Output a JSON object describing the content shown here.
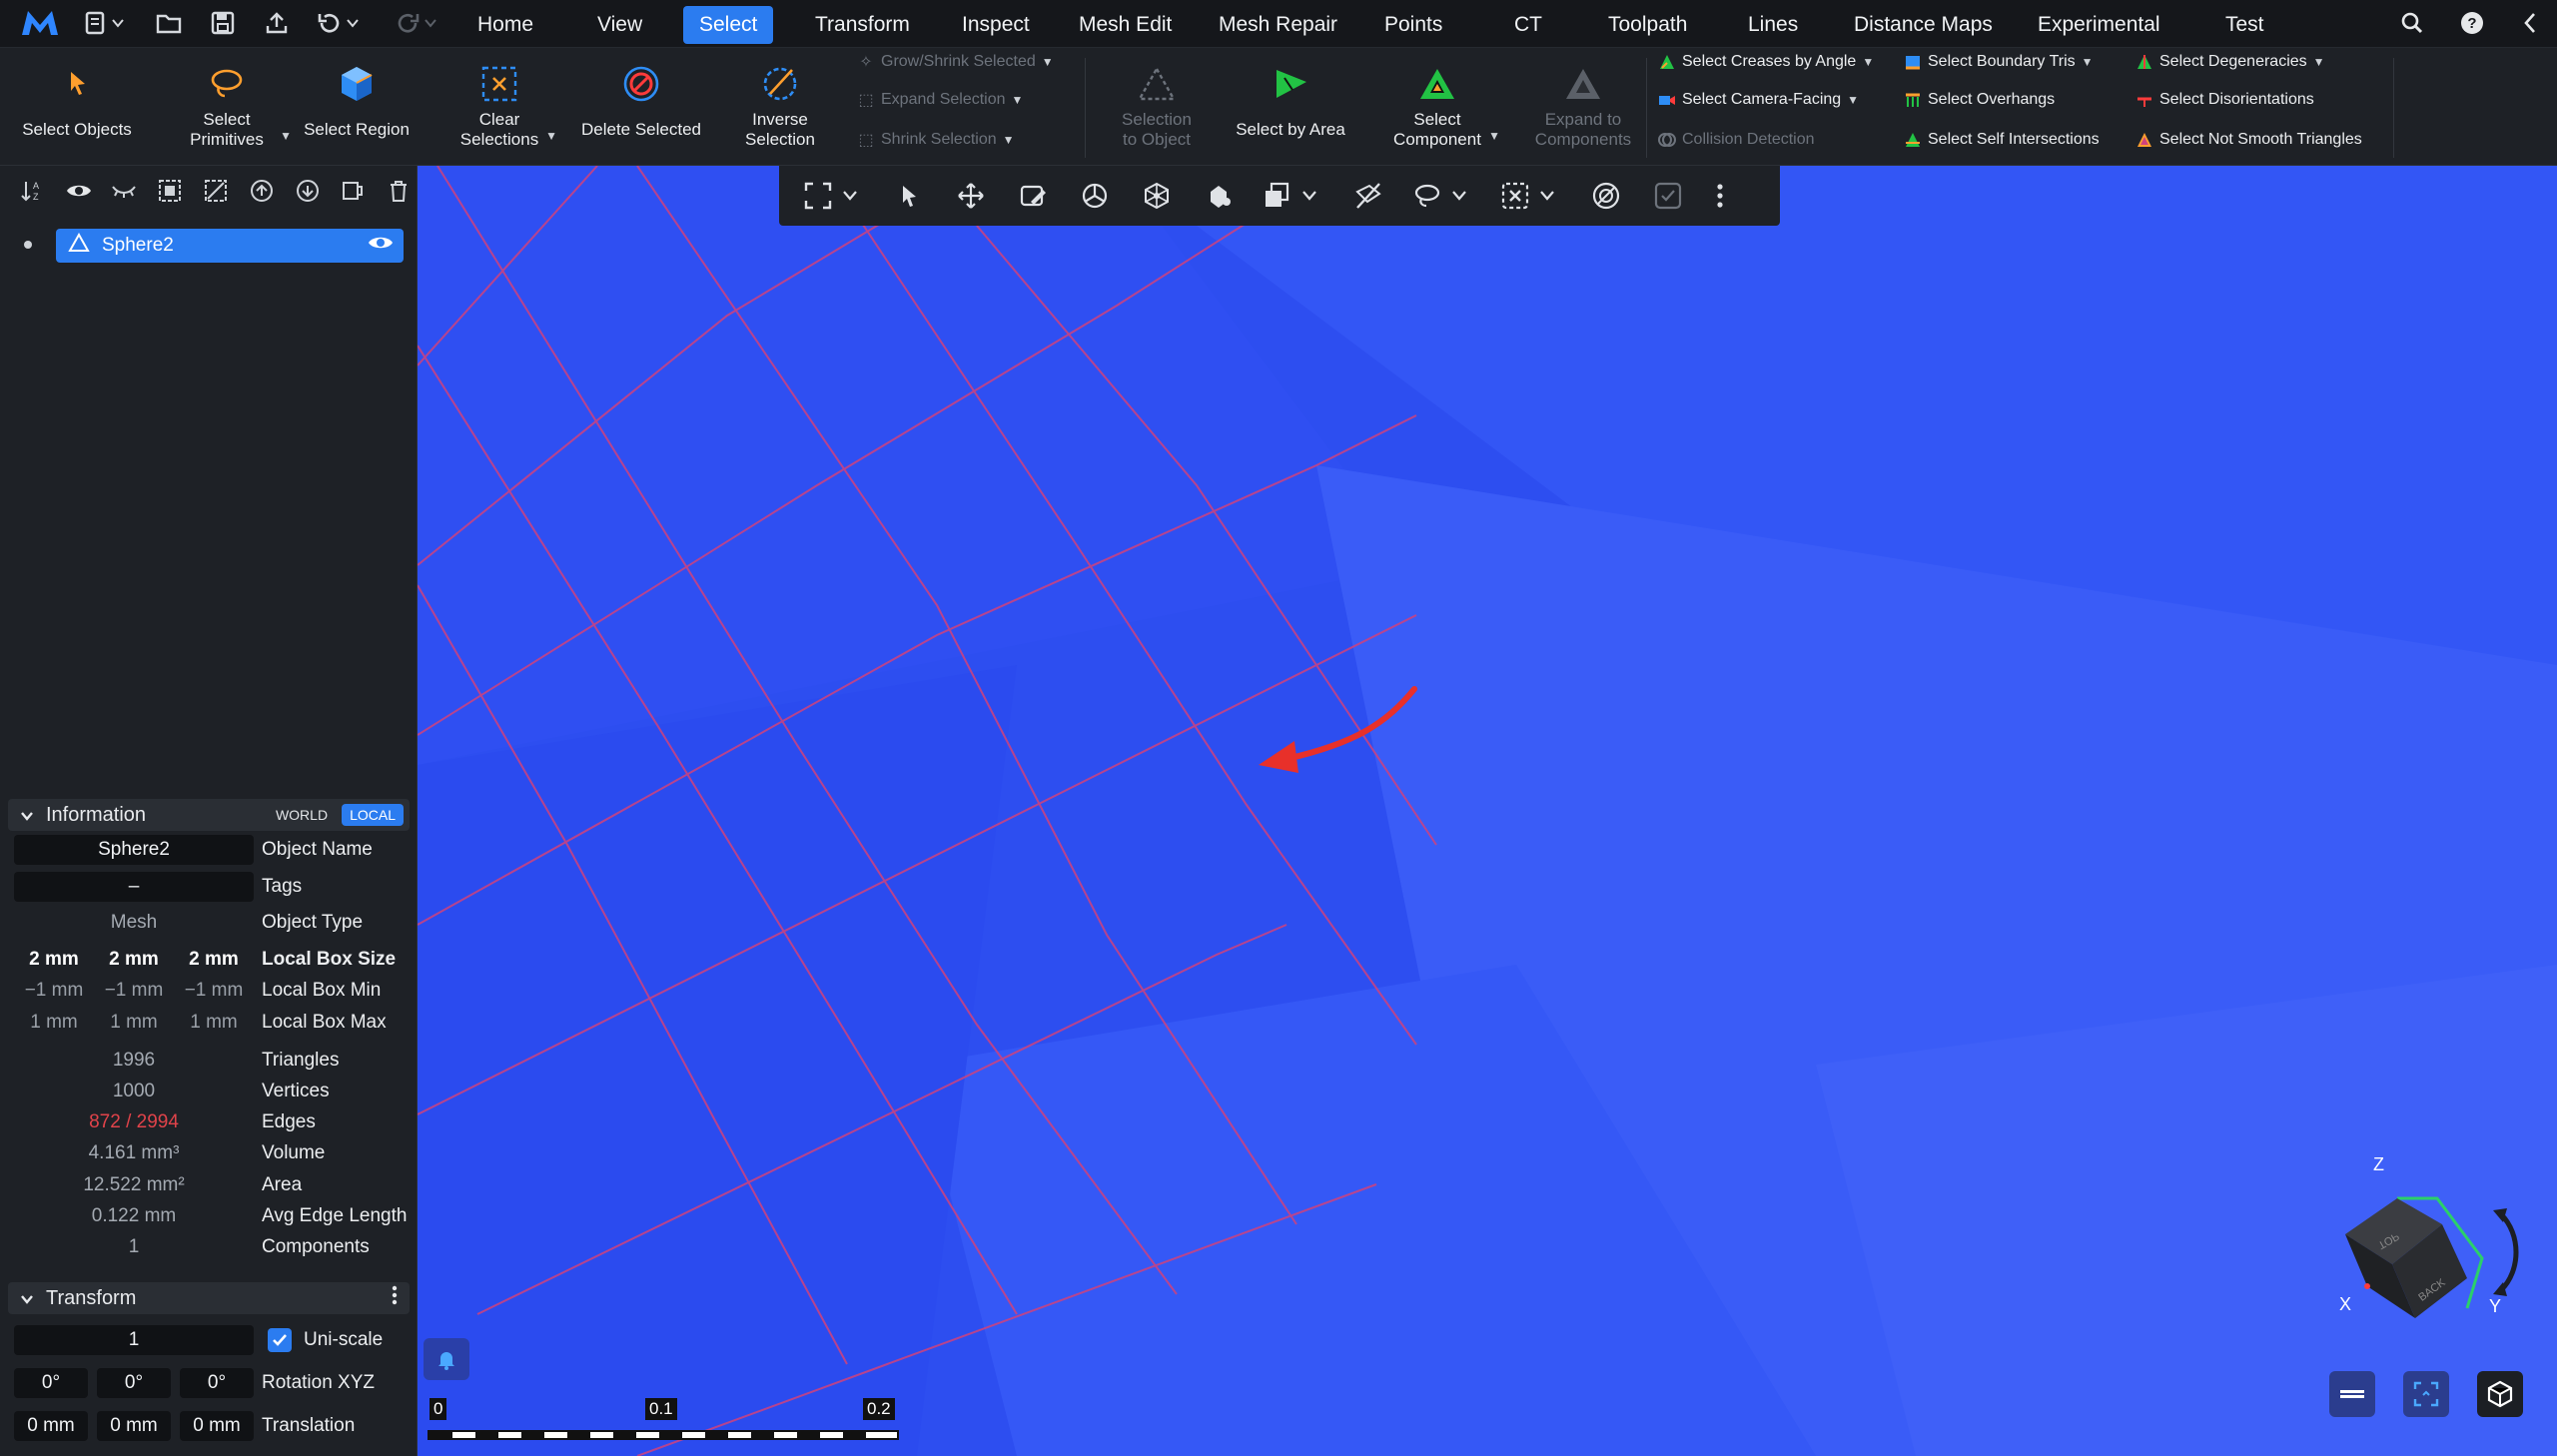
{
  "colors": {
    "accent": "#2b7cf0",
    "viewport_bg": "#2d4ef0",
    "wire": "#d0427d",
    "arrow": "#e8302a",
    "edges_warn": "#e0434a"
  },
  "menu": {
    "items": [
      {
        "label": "Home",
        "active": false
      },
      {
        "label": "View",
        "active": false
      },
      {
        "label": "Select",
        "active": true
      },
      {
        "label": "Transform",
        "active": false
      },
      {
        "label": "Inspect",
        "active": false
      },
      {
        "label": "Mesh Edit",
        "active": false
      },
      {
        "label": "Mesh Repair",
        "active": false
      },
      {
        "label": "Points",
        "active": false
      },
      {
        "label": "CT",
        "active": false
      },
      {
        "label": "Toolpath",
        "active": false
      },
      {
        "label": "Lines",
        "active": false
      },
      {
        "label": "Distance Maps",
        "active": false
      },
      {
        "label": "Experimental",
        "active": false
      },
      {
        "label": "Test",
        "active": false
      }
    ]
  },
  "ribbon": {
    "select_objects": "Select Objects",
    "select_primitives": "Select\nPrimitives",
    "select_region": "Select Region",
    "clear_selections": "Clear\nSelections",
    "delete_selected": "Delete Selected",
    "inverse_selection": "Inverse\nSelection",
    "grow_shrink": "Grow/Shrink Selected",
    "expand_selection": "Expand Selection",
    "shrink_selection": "Shrink Selection",
    "selection_to_object": "Selection\nto Object",
    "select_by_area": "Select by Area",
    "select_component": "Select\nComponent",
    "expand_to_components": "Expand to\nComponents",
    "creases": "Select Creases by Angle",
    "camera_facing": "Select Camera-Facing",
    "collision": "Collision Detection",
    "boundary": "Select Boundary Tris",
    "overhangs": "Select Overhangs",
    "self_intersections": "Select Self Intersections",
    "degeneracies": "Select Degeneracies",
    "disorientations": "Select Disorientations",
    "not_smooth": "Select Not Smooth Triangles"
  },
  "scene": {
    "object_name": "Sphere2"
  },
  "info": {
    "title": "Information",
    "world": "WORLD",
    "local": "LOCAL",
    "name_value": "Sphere2",
    "name_label": "Object Name",
    "tags_value": "–",
    "tags_label": "Tags",
    "type_value": "Mesh",
    "type_label": "Object Type",
    "box_size": [
      "2 mm",
      "2 mm",
      "2 mm"
    ],
    "box_size_label": "Local Box Size",
    "box_min": [
      "−1 mm",
      "−1 mm",
      "−1 mm"
    ],
    "box_min_label": "Local Box Min",
    "box_max": [
      "1 mm",
      "1 mm",
      "1 mm"
    ],
    "box_max_label": "Local Box Max",
    "triangles": "1996",
    "triangles_label": "Triangles",
    "vertices": "1000",
    "vertices_label": "Vertices",
    "edges": "872 / 2994",
    "edges_label": "Edges",
    "volume": "4.161 mm³",
    "volume_label": "Volume",
    "area": "12.522 mm²",
    "area_label": "Area",
    "avg_edge": "0.122 mm",
    "avg_edge_label": "Avg Edge Length",
    "components": "1",
    "components_label": "Components"
  },
  "transform": {
    "title": "Transform",
    "scale": "1",
    "uniscale": "Uni-scale",
    "rotation": [
      "0°",
      "0°",
      "0°"
    ],
    "rotation_label": "Rotation XYZ",
    "translation": [
      "0 mm",
      "0 mm",
      "0 mm"
    ],
    "translation_label": "Translation"
  },
  "ruler": {
    "labels": [
      "0",
      "0.1",
      "0.2"
    ]
  },
  "gizmo": {
    "z": "Z",
    "x": "X",
    "y": "Y",
    "top": "TOP",
    "back": "BACK"
  }
}
